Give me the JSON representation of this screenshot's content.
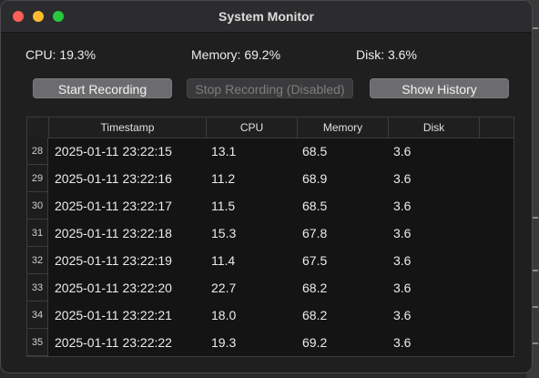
{
  "window": {
    "title": "System Monitor"
  },
  "stats": {
    "cpu": "CPU: 19.3%",
    "memory": "Memory: 69.2%",
    "disk": "Disk: 3.6%"
  },
  "buttons": {
    "start": "Start Recording",
    "stop": "Stop Recording (Disabled)",
    "history": "Show History"
  },
  "table": {
    "headers": [
      "Timestamp",
      "CPU",
      "Memory",
      "Disk"
    ],
    "rows": [
      {
        "num": "28",
        "timestamp": "2025-01-11 23:22:15",
        "cpu": "13.1",
        "memory": "68.5",
        "disk": "3.6"
      },
      {
        "num": "29",
        "timestamp": "2025-01-11 23:22:16",
        "cpu": "11.2",
        "memory": "68.9",
        "disk": "3.6"
      },
      {
        "num": "30",
        "timestamp": "2025-01-11 23:22:17",
        "cpu": "11.5",
        "memory": "68.5",
        "disk": "3.6"
      },
      {
        "num": "31",
        "timestamp": "2025-01-11 23:22:18",
        "cpu": "15.3",
        "memory": "67.8",
        "disk": "3.6"
      },
      {
        "num": "32",
        "timestamp": "2025-01-11 23:22:19",
        "cpu": "11.4",
        "memory": "67.5",
        "disk": "3.6"
      },
      {
        "num": "33",
        "timestamp": "2025-01-11 23:22:20",
        "cpu": "22.7",
        "memory": "68.2",
        "disk": "3.6"
      },
      {
        "num": "34",
        "timestamp": "2025-01-11 23:22:21",
        "cpu": "18.0",
        "memory": "68.2",
        "disk": "3.6"
      },
      {
        "num": "35",
        "timestamp": "2025-01-11 23:22:22",
        "cpu": "19.3",
        "memory": "69.2",
        "disk": "3.6"
      }
    ]
  },
  "colors": {
    "close": "#ff5f57",
    "minimize": "#febc2e",
    "maximize": "#28c840"
  }
}
